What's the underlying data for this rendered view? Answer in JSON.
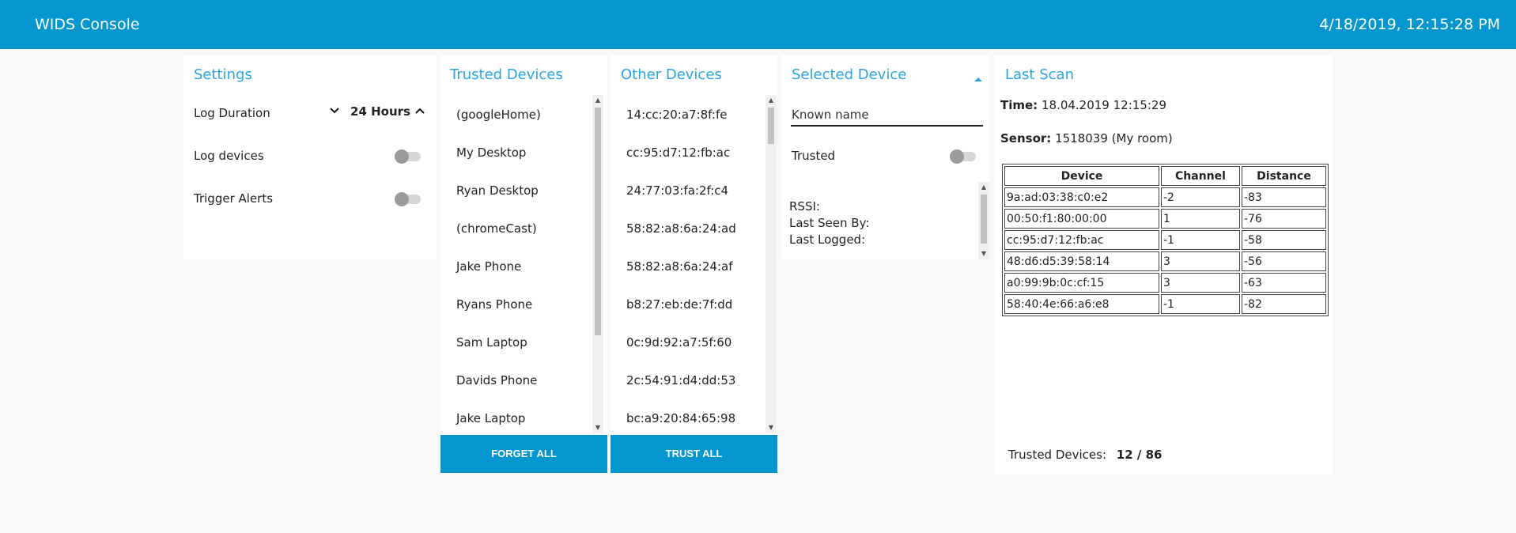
{
  "header": {
    "title": "WIDS Console",
    "datetime": "4/18/2019, 12:15:28 PM"
  },
  "settings": {
    "title": "Settings",
    "log_duration_label": "Log Duration",
    "log_duration_value": "24 Hours",
    "log_devices_label": "Log devices",
    "trigger_alerts_label": "Trigger Alerts"
  },
  "trusted": {
    "title": "Trusted Devices",
    "items": [
      "(googleHome)",
      "My Desktop",
      "Ryan Desktop",
      "(chromeCast)",
      "Jake Phone",
      "Ryans Phone",
      "Sam Laptop",
      "Davids Phone",
      "Jake Laptop"
    ],
    "button": "FORGET ALL"
  },
  "other": {
    "title": "Other Devices",
    "items": [
      "14:cc:20:a7:8f:fe",
      "cc:95:d7:12:fb:ac",
      "24:77:03:fa:2f:c4",
      "58:82:a8:6a:24:ad",
      "58:82:a8:6a:24:af",
      "b8:27:eb:de:7f:dd",
      "0c:9d:92:a7:5f:60",
      "2c:54:91:d4:dd:53",
      "bc:a9:20:84:65:98"
    ],
    "button": "TRUST ALL"
  },
  "selected": {
    "title": "Selected Device",
    "known_name_placeholder": "Known name",
    "trusted_label": "Trusted",
    "rssi_label": "RSSI:",
    "last_seen_label": "Last Seen By:",
    "last_logged_label": "Last Logged:"
  },
  "scan": {
    "title": "Last Scan",
    "time_label": "Time:",
    "time_value": "18.04.2019 12:15:29",
    "sensor_label": "Sensor:",
    "sensor_value": "1518039 (My room)",
    "columns": [
      "Device",
      "Channel",
      "Distance"
    ],
    "rows": [
      [
        "9a:ad:03:38:c0:e2",
        "-2",
        "-83"
      ],
      [
        "00:50:f1:80:00:00",
        "1",
        "-76"
      ],
      [
        "cc:95:d7:12:fb:ac",
        "-1",
        "-58"
      ],
      [
        "48:d6:d5:39:58:14",
        "3",
        "-56"
      ],
      [
        "a0:99:9b:0c:cf:15",
        "3",
        "-63"
      ],
      [
        "58:40:4e:66:a6:e8",
        "-1",
        "-82"
      ]
    ],
    "trusted_devices_label": "Trusted Devices:",
    "trusted_devices_value": "12 / 86"
  },
  "colors": {
    "accent": "#0496cf",
    "title_blue": "#2aa6df"
  },
  "icons": {
    "stepper_down": "chevron-down-icon",
    "stepper_up": "chevron-up-icon",
    "collapse": "caret-up-icon"
  }
}
